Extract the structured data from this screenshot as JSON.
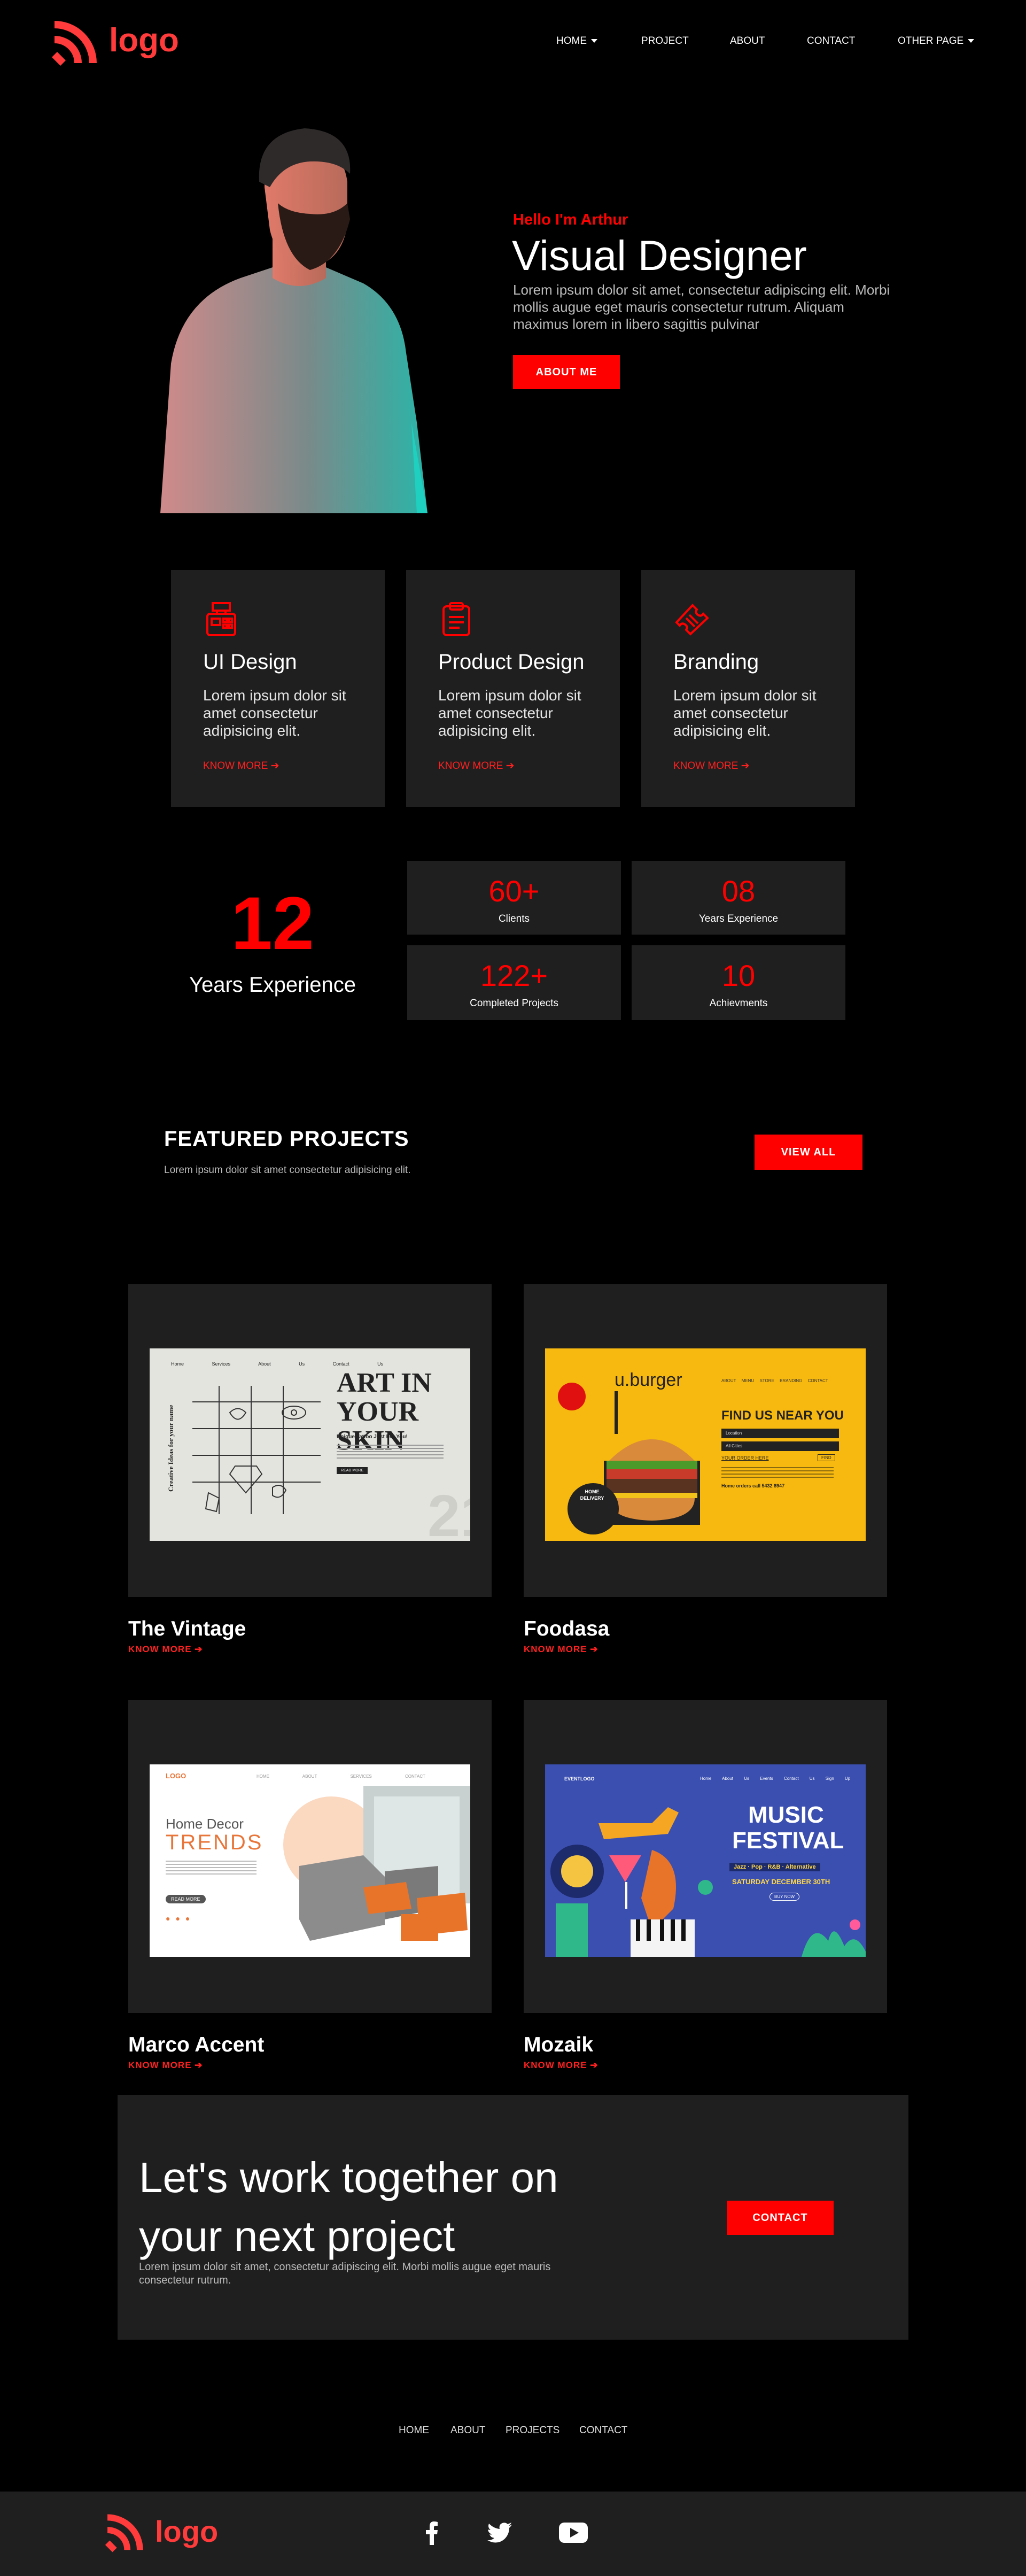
{
  "brand": {
    "logo_text": "logo",
    "accent": "#ff0000"
  },
  "nav": {
    "home": "HOME",
    "project": "PROJECT",
    "about": "ABOUT",
    "contact": "CONTACT",
    "other": "OTHER PAGE"
  },
  "hero": {
    "greeting": "Hello I'm Arthur",
    "title": "Visual Designer",
    "description": "Lorem ipsum dolor sit amet, consectetur adipiscing elit. Morbi mollis augue eget mauris consectetur rutrum. Aliquam maximus lorem in libero sagittis pulvinar",
    "button": "ABOUT ME"
  },
  "services": [
    {
      "icon": "cash-register-icon",
      "title": "UI Design",
      "description": "Lorem ipsum dolor sit amet consectetur adipisicing elit.",
      "link": "KNOW MORE"
    },
    {
      "icon": "clipboard-icon",
      "title": "Product Design",
      "description": "Lorem ipsum dolor sit amet consectetur adipisicing elit.",
      "link": "KNOW MORE"
    },
    {
      "icon": "ticket-icon",
      "title": "Branding",
      "description": "Lorem ipsum dolor sit amet consectetur adipisicing elit.",
      "link": "KNOW MORE"
    }
  ],
  "experience": {
    "big_number": "12",
    "big_label": "Years Experience",
    "stats": [
      {
        "value": "60+",
        "label": "Clients"
      },
      {
        "value": "08",
        "label": "Years Experience"
      },
      {
        "value": "122+",
        "label": "Completed Projects"
      },
      {
        "value": "10",
        "label": "Achievments"
      }
    ]
  },
  "featured": {
    "title": "FEATURED PROJECTS",
    "subtitle": "Lorem ipsum dolor sit amet consectetur adipisicing elit.",
    "button": "VIEW ALL"
  },
  "projects": [
    {
      "name": "The Vintage",
      "link": "KNOW MORE",
      "thumb": {
        "nav": [
          "Home",
          "Services",
          "About Us",
          "Contact Us"
        ],
        "side": "Creative Ideas for your name",
        "headline_1": "ART IN",
        "headline_2": "YOUR SKIN",
        "tagline": "Unique Tattoo Just For You!",
        "cta": "READ MORE"
      }
    },
    {
      "name": "Foodasa",
      "link": "KNOW MORE",
      "thumb": {
        "brand": "u.burger",
        "nav": [
          "ABOUT",
          "MENU",
          "STORE",
          "BRANDING",
          "CONTACT"
        ],
        "headline": "FIND US NEAR YOU",
        "field_1": "Location",
        "field_2": "All Cities",
        "link": "YOUR ORDER HERE",
        "find": "FIND",
        "badge_1": "HOME",
        "badge_2": "DELIVERY",
        "note": "Home orders call 5432 8947"
      }
    },
    {
      "name": "Marco Accent",
      "link": "KNOW MORE",
      "thumb": {
        "brand": "LOGO",
        "nav": [
          "HOME",
          "ABOUT",
          "SERVICES",
          "CONTACT"
        ],
        "headline_1": "Home Decor",
        "headline_2": "TRENDS",
        "cta": "READ MORE"
      }
    },
    {
      "name": "Mozaik",
      "link": "KNOW MORE",
      "thumb": {
        "brand": "EVENTLOGO",
        "nav": [
          "Home",
          "About Us",
          "Events",
          "Contact Us",
          "Sign Up"
        ],
        "headline_1": "MUSIC",
        "headline_2": "FESTIVAL",
        "genres": "Jazz · Pop · R&B · Alternative",
        "date": "SATURDAY DECEMBER 30TH",
        "cta": "BUY NOW"
      }
    }
  ],
  "cta": {
    "line1": "Let's work together on",
    "line2": "your next project",
    "description": "Lorem ipsum dolor sit amet, consectetur adipiscing elit. Morbi mollis augue eget mauris consectetur rutrum.",
    "button": "CONTACT"
  },
  "footer": {
    "links": [
      "HOME",
      "ABOUT",
      "PROJECTS",
      "CONTACT"
    ],
    "logo_text": "logo",
    "social": [
      "facebook-icon",
      "twitter-icon",
      "youtube-icon"
    ]
  }
}
